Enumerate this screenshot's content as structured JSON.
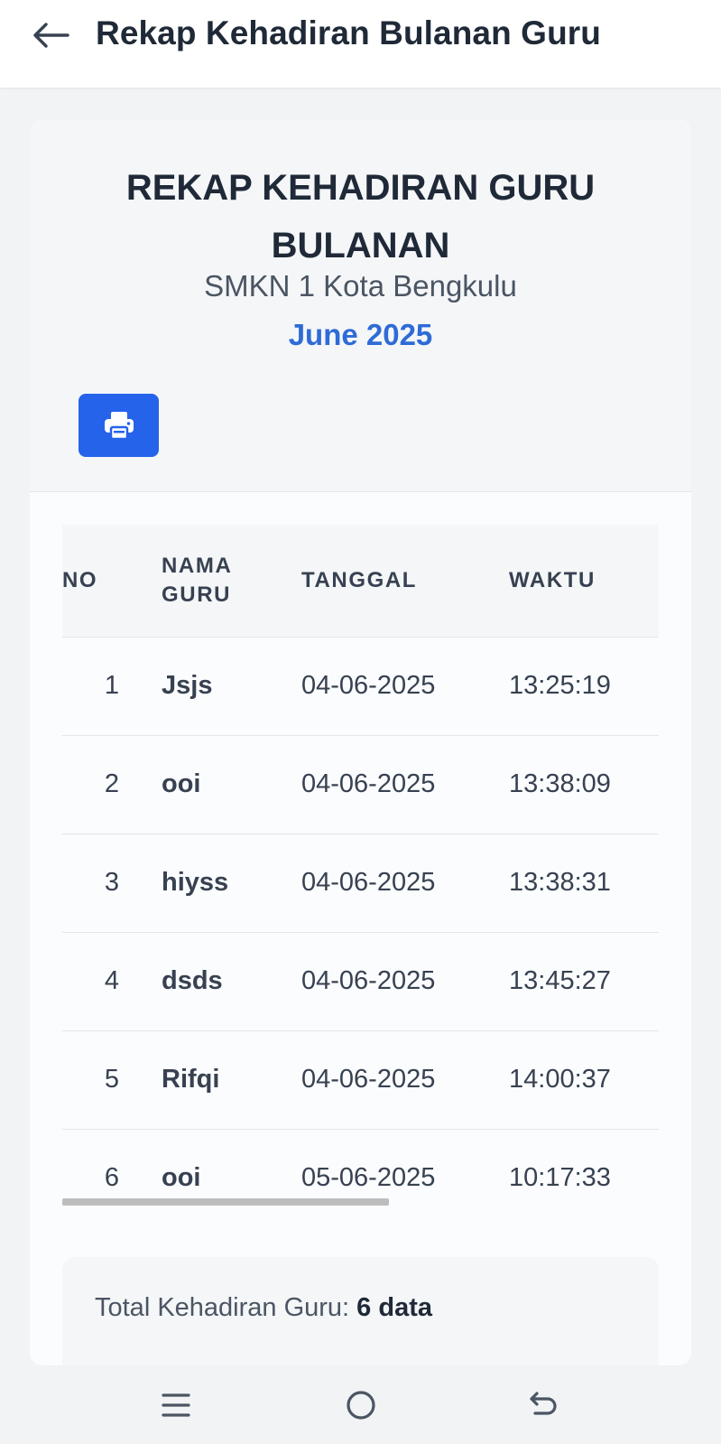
{
  "appbar": {
    "title": "Rekap Kehadiran Bulanan Guru",
    "back_icon": "arrow-left-icon"
  },
  "report": {
    "title": "REKAP KEHADIRAN GURU BULANAN",
    "school": "SMKN 1 Kota Bengkulu",
    "period": "June 2025",
    "print_icon": "printer-icon"
  },
  "table": {
    "headers": {
      "no": "NO",
      "name_line1": "NAMA",
      "name_line2": "GURU",
      "date": "TANGGAL",
      "time": "WAKTU"
    },
    "rows": [
      {
        "no": "1",
        "name": "Jsjs",
        "date": "04-06-2025",
        "time": "13:25:19"
      },
      {
        "no": "2",
        "name": "ooi",
        "date": "04-06-2025",
        "time": "13:38:09"
      },
      {
        "no": "3",
        "name": "hiyss",
        "date": "04-06-2025",
        "time": "13:38:31"
      },
      {
        "no": "4",
        "name": "dsds",
        "date": "04-06-2025",
        "time": "13:45:27"
      },
      {
        "no": "5",
        "name": "Rifqi",
        "date": "04-06-2025",
        "time": "14:00:37"
      },
      {
        "no": "6",
        "name": "ooi",
        "date": "05-06-2025",
        "time": "10:17:33"
      }
    ]
  },
  "summary": {
    "label": "Total Kehadiran Guru: ",
    "value": "6 data"
  },
  "navbar": {
    "menu_icon": "menu-icon",
    "home_icon": "home-circle-icon",
    "back_icon": "back-nav-icon"
  },
  "colors": {
    "accent": "#2563eb",
    "period": "#2e6bd6"
  }
}
